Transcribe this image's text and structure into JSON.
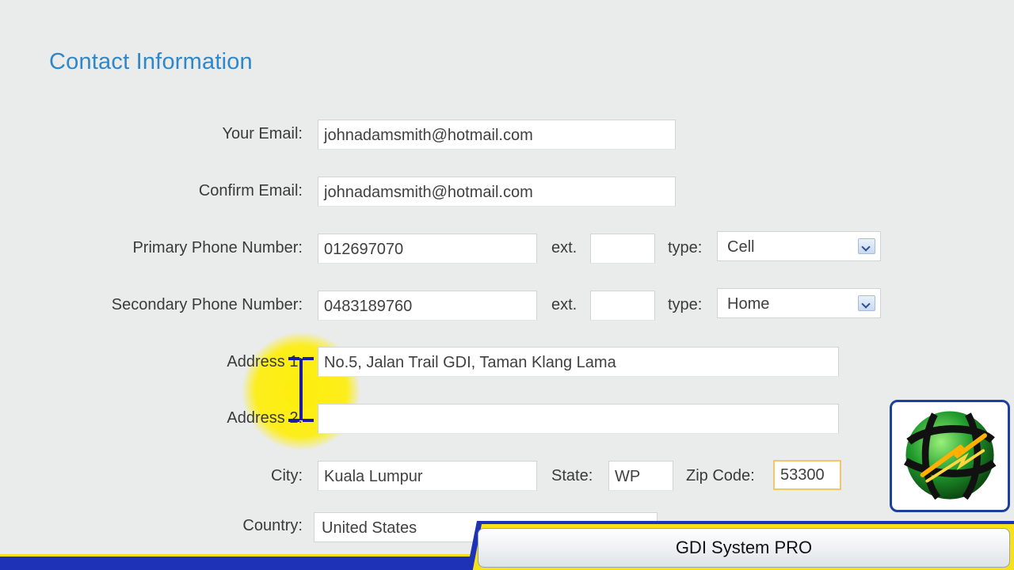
{
  "section": {
    "title": "Contact Information"
  },
  "email": {
    "label": "Your Email:",
    "value": "johnadamsmith@hotmail.com"
  },
  "confirm_email": {
    "label": "Confirm Email:",
    "value": "johnadamsmith@hotmail.com"
  },
  "primary_phone": {
    "label": "Primary Phone Number:",
    "value": "012697070",
    "ext_label": "ext.",
    "ext_value": "",
    "type_label": "type:",
    "type_value": "Cell"
  },
  "secondary_phone": {
    "label": "Secondary Phone Number:",
    "value": "0483189760",
    "ext_label": "ext.",
    "ext_value": "",
    "type_label": "type:",
    "type_value": "Home"
  },
  "address1": {
    "label": "Address 1:",
    "value": "No.5, Jalan Trail GDI, Taman Klang Lama"
  },
  "address2": {
    "label": "Address 2:",
    "value": ""
  },
  "city": {
    "label": "City:",
    "value": "Kuala Lumpur"
  },
  "state": {
    "label": "State:",
    "value": "WP"
  },
  "zip": {
    "label": "Zip Code:",
    "value": "53300"
  },
  "country": {
    "label": "Country:",
    "value": "United States"
  },
  "brand": {
    "name": "GDI System PRO"
  },
  "colors": {
    "title_blue": "#2f86c9",
    "banner_blue": "#1e32b8",
    "banner_yellow": "#f6e11a",
    "highlight_yellow": "#ffee00"
  },
  "icons": {
    "dropdown": "chevron-down-icon",
    "logo": "gdi-globe-logo-icon",
    "text_cursor": "text-cursor-icon"
  }
}
